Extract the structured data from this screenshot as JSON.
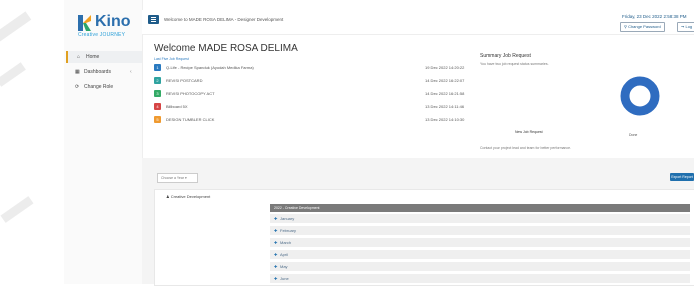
{
  "app": {
    "brand": "Kino",
    "tagline": "Creative JOURNEY",
    "top_message": "Welcome to MADE ROSA DELIMA - Designer Development",
    "datetime": "Friday, 23 Dec 2022 2:58:38 PM",
    "change_password": "Change Password",
    "logout": "Log"
  },
  "sidebar": {
    "items": [
      {
        "label": "Home",
        "icon": "home-icon"
      },
      {
        "label": "Dashboards",
        "icon": "dashboard-icon"
      },
      {
        "label": "Change Role",
        "icon": "refresh-icon"
      }
    ]
  },
  "main": {
    "welcome": "Welcome MADE ROSA DELIMA",
    "last_jobs_label": "Last Five Job Request",
    "jobs": [
      {
        "num": "1",
        "name": "Q-Life - Recipe Spanduk (Ayodah Medika Farma)",
        "date": "19 Dec 2022 14:20:22",
        "color": "#2a7ac0"
      },
      {
        "num": "2",
        "name": "REVISI POSTCARD",
        "date": "14 Dec 2022 16:22:07",
        "color": "#2fa3a0"
      },
      {
        "num": "3",
        "name": "REVISI PHOTOCOPY ACT",
        "date": "14 Dec 2022 16:21:58",
        "color": "#33aa66"
      },
      {
        "num": "4",
        "name": "Billboard 5X",
        "date": "13 Dec 2022 14:11:46",
        "color": "#d64545"
      },
      {
        "num": "5",
        "name": "DESIGN TUMBLER CLICK",
        "date": "13 Dec 2022 14:10:30",
        "color": "#ef9a30"
      }
    ],
    "summary_title": "Summary Job Request",
    "summary_subtitle": "You have two job request status summaries.",
    "new_job_label": "New Job Request",
    "done_label": "Done",
    "contact_text": "Contact your project lead and team for better performance.",
    "donut_color": "#2f6cc0",
    "done_fraction": 1.0
  },
  "filter": {
    "choose_year": "Choose a Year",
    "export_label": "Export Report"
  },
  "department": {
    "label": "Creative Development",
    "table_header": "2022 - Creative Development",
    "months": [
      "January",
      "February",
      "March",
      "April",
      "May",
      "June"
    ]
  }
}
